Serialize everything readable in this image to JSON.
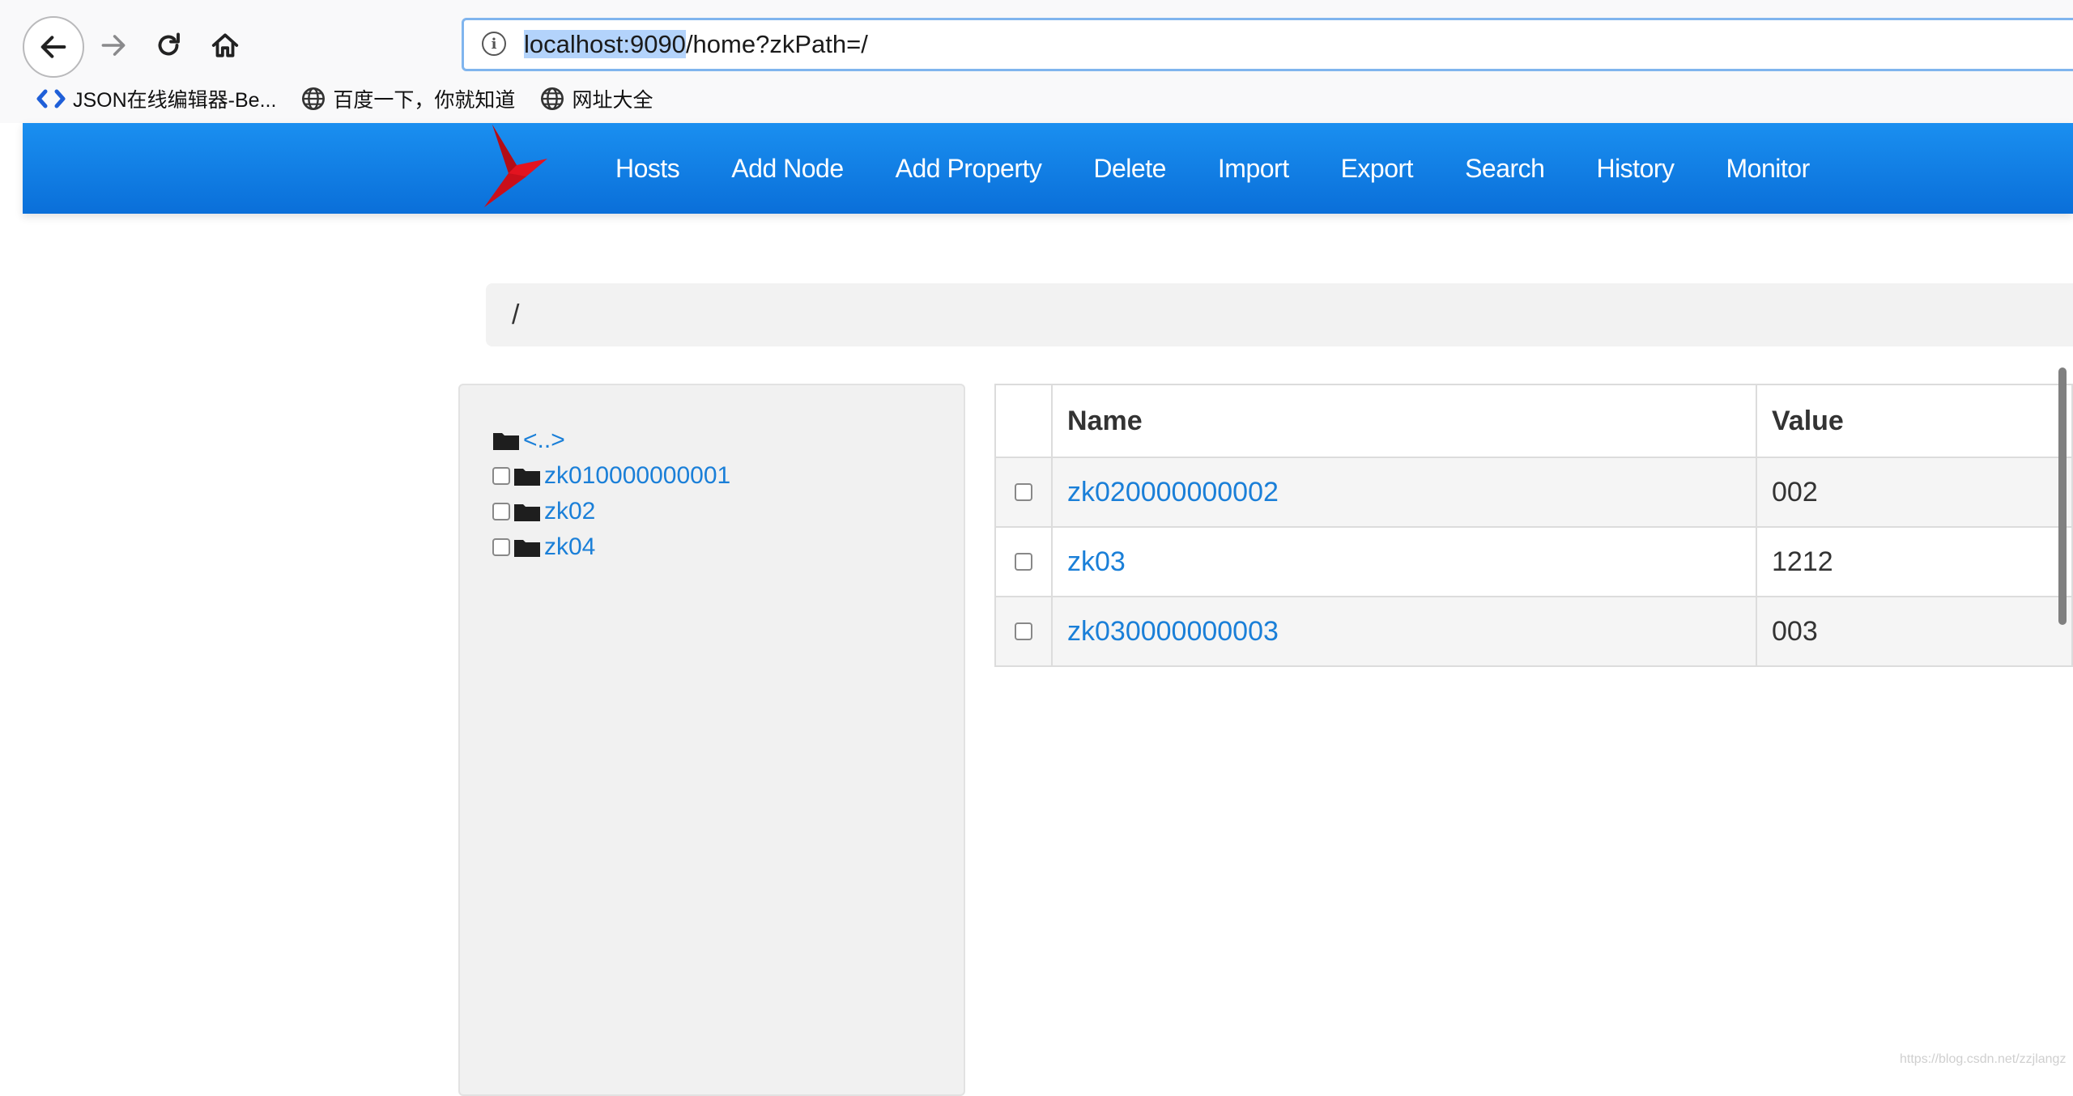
{
  "browser": {
    "url_host": "localhost:9090",
    "url_path": "/home?zkPath=/",
    "bookmarks": [
      {
        "label": "JSON在线编辑器-Be...",
        "icon": "json-code-icon"
      },
      {
        "label": "百度一下，你就知道",
        "icon": "globe-icon"
      },
      {
        "label": "网址大全",
        "icon": "globe-icon"
      }
    ]
  },
  "topnav": {
    "items": [
      "Hosts",
      "Add Node",
      "Add Property",
      "Delete",
      "Import",
      "Export",
      "Search",
      "History",
      "Monitor"
    ],
    "brand_color": "#0a7be0",
    "logo_color": "#e3131f"
  },
  "breadcrumb": {
    "path": "/"
  },
  "tree": {
    "parent_link": "<..>",
    "nodes": [
      "zk010000000001",
      "zk02",
      "zk04"
    ]
  },
  "table": {
    "headers": {
      "name": "Name",
      "value": "Value"
    },
    "rows": [
      {
        "name": "zk020000000002",
        "value": "002"
      },
      {
        "name": "zk03",
        "value": "1212"
      },
      {
        "name": "zk030000000003",
        "value": "003"
      }
    ]
  },
  "watermark": "https://blog.csdn.net/zzjlangz"
}
